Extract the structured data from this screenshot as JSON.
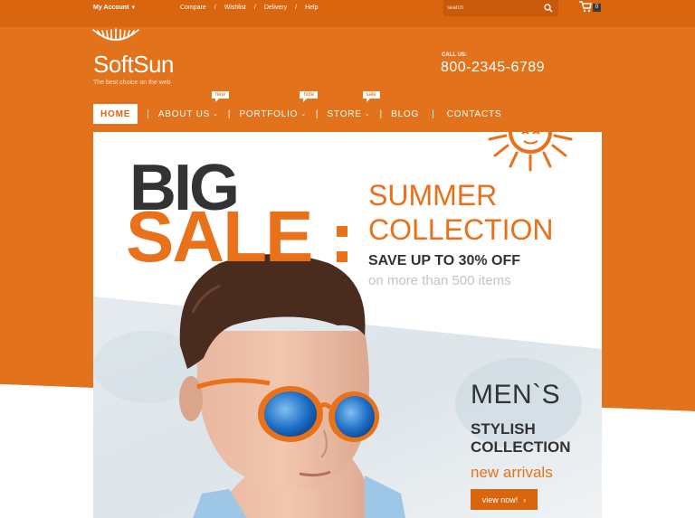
{
  "topbar": {
    "my_account": "My Account",
    "links": [
      "Compare",
      "Wishlist",
      "Delivery",
      "Help"
    ],
    "search_placeholder": "search",
    "cart_count": "0"
  },
  "logo": {
    "name": "SoftSun",
    "tagline": "The best choice on the web"
  },
  "contact": {
    "label": "CALL US:",
    "phone": "800-2345-6789"
  },
  "nav": {
    "home": "HOME",
    "about": "ABOUT US",
    "portfolio": "PORTFOLIO",
    "store": "STORE",
    "blog": "BLOG",
    "contacts": "CONTACTS",
    "tag_new": "new",
    "tag_hote": "hote",
    "tag_sale": "sale"
  },
  "banner": {
    "big": "BIG",
    "sale": "SALE",
    "summer1": "SUMMER",
    "summer2": "COLLECTION",
    "save": "SAVE UP TO 30% OFF",
    "more": "on more than 500 items",
    "mens": "MEN`S",
    "stylish1": "STYLISH",
    "stylish2": "COLLECTION",
    "new_arrivals": "new arrivals",
    "view_now": "view now!"
  },
  "colors": {
    "accent": "#e8711a",
    "dark_accent": "#d9650f",
    "text_dark": "#333333"
  },
  "icons": [
    "sun-logo-icon",
    "search-icon",
    "cart-icon",
    "chevron-down-icon",
    "chevron-right-icon",
    "sun-decoration-icon"
  ]
}
